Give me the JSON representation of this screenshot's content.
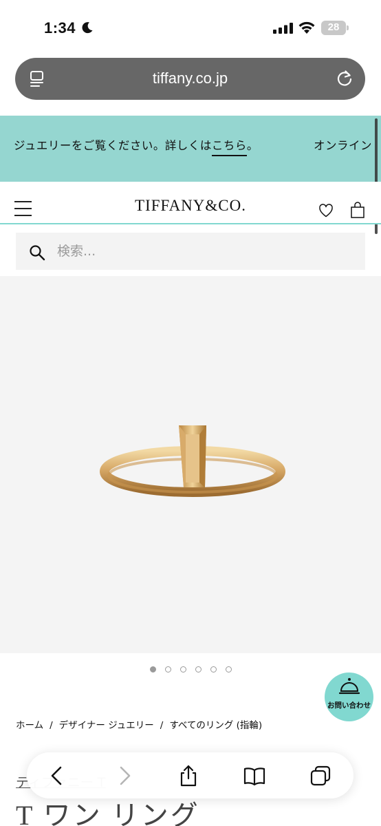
{
  "status_bar": {
    "time": "1:34",
    "battery": "28"
  },
  "address_bar": {
    "url": "tiffany.co.jp"
  },
  "banner": {
    "text_before": "ジュエリーをご覧ください。詳しくは",
    "link": "こちら",
    "text_after": "。",
    "next_text": "オンライン"
  },
  "header": {
    "logo": "TIFFANY&CO."
  },
  "search": {
    "placeholder": "検索..."
  },
  "carousel": {
    "count": 6,
    "active_index": 0
  },
  "contact_button": {
    "label": "お問い合わせ"
  },
  "breadcrumb": {
    "items": [
      "ホーム",
      "デザイナー ジュエリー",
      "すべてのリング (指輪)"
    ],
    "separator": "/"
  },
  "product": {
    "collection": "ティファニー T",
    "title": "T ワン リング"
  },
  "colors": {
    "brand_blue": "#81d8d0",
    "banner_bg": "#95d6d0",
    "address_bar_bg": "#676767"
  },
  "icons": {
    "address_bar": [
      "reader-icon",
      "reload-icon"
    ],
    "header": [
      "hamburger-icon",
      "heart-icon",
      "bag-icon"
    ],
    "toolbar": [
      "back-icon",
      "forward-icon",
      "share-icon",
      "bookmarks-icon",
      "tabs-icon"
    ]
  }
}
